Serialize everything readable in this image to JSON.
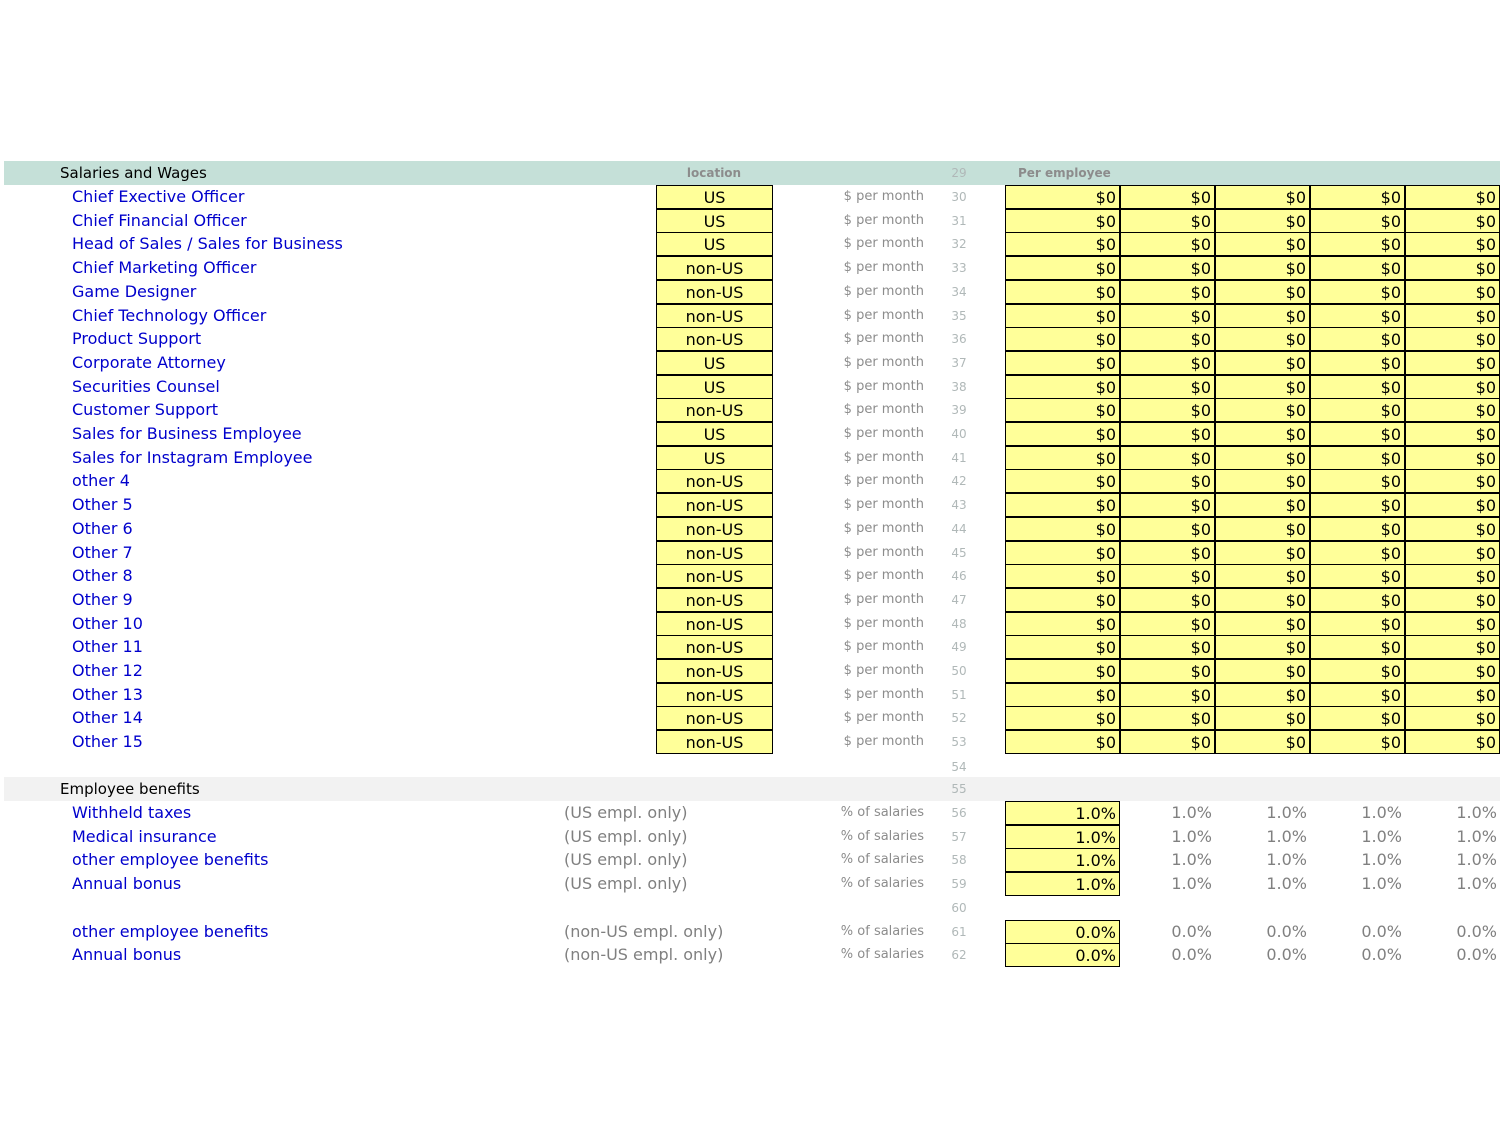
{
  "salaries": {
    "title": "Salaries and Wages",
    "location_header": "location",
    "per_employee_header": "Per employee",
    "header_row": "29",
    "rows": [
      {
        "label": "Chief Exective Officer",
        "location": "US",
        "unit": "$ per month",
        "row": "30",
        "values": [
          "$0",
          "$0",
          "$0",
          "$0",
          "$0"
        ]
      },
      {
        "label": "Chief Financial Officer",
        "location": "US",
        "unit": "$ per month",
        "row": "31",
        "values": [
          "$0",
          "$0",
          "$0",
          "$0",
          "$0"
        ]
      },
      {
        "label": "Head of Sales / Sales for Business",
        "location": "US",
        "unit": "$ per month",
        "row": "32",
        "values": [
          "$0",
          "$0",
          "$0",
          "$0",
          "$0"
        ]
      },
      {
        "label": "Chief Marketing Officer",
        "location": "non-US",
        "unit": "$ per month",
        "row": "33",
        "values": [
          "$0",
          "$0",
          "$0",
          "$0",
          "$0"
        ]
      },
      {
        "label": "Game Designer",
        "location": "non-US",
        "unit": "$ per month",
        "row": "34",
        "values": [
          "$0",
          "$0",
          "$0",
          "$0",
          "$0"
        ]
      },
      {
        "label": "Chief Technology Officer",
        "location": "non-US",
        "unit": "$ per month",
        "row": "35",
        "values": [
          "$0",
          "$0",
          "$0",
          "$0",
          "$0"
        ]
      },
      {
        "label": "Product Support",
        "location": "non-US",
        "unit": "$ per month",
        "row": "36",
        "values": [
          "$0",
          "$0",
          "$0",
          "$0",
          "$0"
        ]
      },
      {
        "label": "Corporate Attorney",
        "location": "US",
        "unit": "$ per month",
        "row": "37",
        "values": [
          "$0",
          "$0",
          "$0",
          "$0",
          "$0"
        ]
      },
      {
        "label": "Securities Counsel",
        "location": "US",
        "unit": "$ per month",
        "row": "38",
        "values": [
          "$0",
          "$0",
          "$0",
          "$0",
          "$0"
        ]
      },
      {
        "label": "Customer Support",
        "location": "non-US",
        "unit": "$ per month",
        "row": "39",
        "values": [
          "$0",
          "$0",
          "$0",
          "$0",
          "$0"
        ]
      },
      {
        "label": "Sales for Business Employee",
        "location": "US",
        "unit": "$ per month",
        "row": "40",
        "values": [
          "$0",
          "$0",
          "$0",
          "$0",
          "$0"
        ]
      },
      {
        "label": "Sales for  Instagram Employee",
        "location": "US",
        "unit": "$ per month",
        "row": "41",
        "values": [
          "$0",
          "$0",
          "$0",
          "$0",
          "$0"
        ]
      },
      {
        "label": "other 4",
        "location": "non-US",
        "unit": "$ per month",
        "row": "42",
        "values": [
          "$0",
          "$0",
          "$0",
          "$0",
          "$0"
        ]
      },
      {
        "label": "Other 5",
        "location": "non-US",
        "unit": "$ per month",
        "row": "43",
        "values": [
          "$0",
          "$0",
          "$0",
          "$0",
          "$0"
        ]
      },
      {
        "label": "Other 6",
        "location": "non-US",
        "unit": "$ per month",
        "row": "44",
        "values": [
          "$0",
          "$0",
          "$0",
          "$0",
          "$0"
        ]
      },
      {
        "label": "Other 7",
        "location": "non-US",
        "unit": "$ per month",
        "row": "45",
        "values": [
          "$0",
          "$0",
          "$0",
          "$0",
          "$0"
        ]
      },
      {
        "label": "Other 8",
        "location": "non-US",
        "unit": "$ per month",
        "row": "46",
        "values": [
          "$0",
          "$0",
          "$0",
          "$0",
          "$0"
        ]
      },
      {
        "label": "Other 9",
        "location": "non-US",
        "unit": "$ per month",
        "row": "47",
        "values": [
          "$0",
          "$0",
          "$0",
          "$0",
          "$0"
        ]
      },
      {
        "label": "Other 10",
        "location": "non-US",
        "unit": "$ per month",
        "row": "48",
        "values": [
          "$0",
          "$0",
          "$0",
          "$0",
          "$0"
        ]
      },
      {
        "label": "Other 11",
        "location": "non-US",
        "unit": "$ per month",
        "row": "49",
        "values": [
          "$0",
          "$0",
          "$0",
          "$0",
          "$0"
        ]
      },
      {
        "label": "Other 12",
        "location": "non-US",
        "unit": "$ per month",
        "row": "50",
        "values": [
          "$0",
          "$0",
          "$0",
          "$0",
          "$0"
        ]
      },
      {
        "label": "Other 13",
        "location": "non-US",
        "unit": "$ per month",
        "row": "51",
        "values": [
          "$0",
          "$0",
          "$0",
          "$0",
          "$0"
        ]
      },
      {
        "label": "Other 14",
        "location": "non-US",
        "unit": "$ per month",
        "row": "52",
        "values": [
          "$0",
          "$0",
          "$0",
          "$0",
          "$0"
        ]
      },
      {
        "label": "Other 15",
        "location": "non-US",
        "unit": "$ per month",
        "row": "53",
        "values": [
          "$0",
          "$0",
          "$0",
          "$0",
          "$0"
        ]
      }
    ]
  },
  "blank_row_54": "54",
  "benefits": {
    "title": "Employee benefits",
    "header_row": "55",
    "rows": [
      {
        "label": "Withheld taxes",
        "note": "(US empl. only)",
        "unit": "% of salaries",
        "row": "56",
        "values": [
          "1.0%",
          "1.0%",
          "1.0%",
          "1.0%",
          "1.0%"
        ]
      },
      {
        "label": "Medical insurance",
        "note": "(US empl. only)",
        "unit": "% of salaries",
        "row": "57",
        "values": [
          "1.0%",
          "1.0%",
          "1.0%",
          "1.0%",
          "1.0%"
        ]
      },
      {
        "label": "other employee benefits",
        "note": "(US empl. only)",
        "unit": "% of salaries",
        "row": "58",
        "values": [
          "1.0%",
          "1.0%",
          "1.0%",
          "1.0%",
          "1.0%"
        ]
      },
      {
        "label": "Annual bonus",
        "note": "(US empl. only)",
        "unit": "% of salaries",
        "row": "59",
        "values": [
          "1.0%",
          "1.0%",
          "1.0%",
          "1.0%",
          "1.0%"
        ]
      },
      {
        "spacer": true,
        "row": "60"
      },
      {
        "label": "other employee benefits",
        "note": "(non-US empl. only)",
        "unit": "% of salaries",
        "row": "61",
        "values": [
          "0.0%",
          "0.0%",
          "0.0%",
          "0.0%",
          "0.0%"
        ]
      },
      {
        "label": "Annual bonus",
        "note": "(non-US empl. only)",
        "unit": "% of salaries",
        "row": "62",
        "values": [
          "0.0%",
          "0.0%",
          "0.0%",
          "0.0%",
          "0.0%"
        ]
      }
    ]
  },
  "colors": {
    "header_band": "#c5e0d8",
    "benefits_band": "#f2f2f2",
    "input_fill": "#ffff99",
    "label_blue": "#0000cc"
  }
}
